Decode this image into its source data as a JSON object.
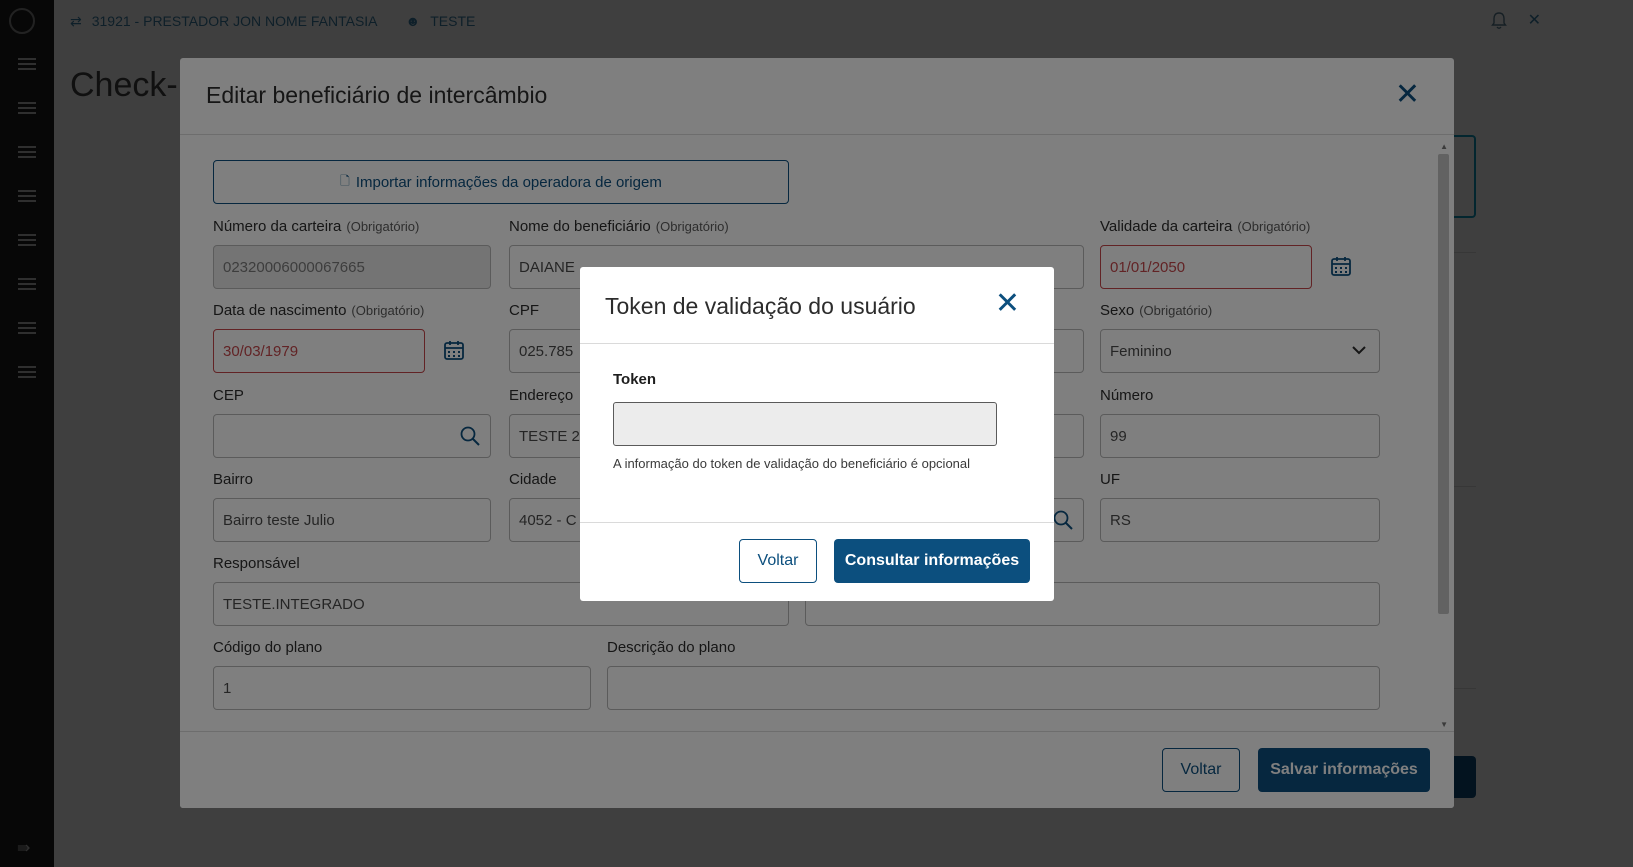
{
  "topbar": {
    "provider": "31921 - PRESTADOR JON NOME FANTASIA",
    "user": "TESTE"
  },
  "page": {
    "title_fragment": "Check-i"
  },
  "edit_modal": {
    "title": "Editar beneficiário de intercâmbio",
    "import_button": "Importar informações da operadora de origem",
    "required_tag": "(Obrigatório)",
    "fields": {
      "card_number": {
        "label": "Número da carteira",
        "value": "02320006000067665"
      },
      "beneficiary_name": {
        "label": "Nome do beneficiário",
        "value": "DAIANE"
      },
      "card_validity": {
        "label": "Validade da carteira",
        "value": "01/01/2050"
      },
      "birth_date": {
        "label": "Data de nascimento",
        "value": "30/03/1979"
      },
      "cpf": {
        "label": "CPF",
        "value": "025.785"
      },
      "sex": {
        "label": "Sexo",
        "value": "Feminino"
      },
      "cep": {
        "label": "CEP",
        "value": ""
      },
      "address": {
        "label": "Endereço",
        "value": "TESTE 2"
      },
      "number": {
        "label": "Número",
        "value": "99"
      },
      "neighborhood": {
        "label": "Bairro",
        "value": "Bairro teste Julio"
      },
      "city": {
        "label": "Cidade",
        "value": "4052 - C"
      },
      "uf": {
        "label": "UF",
        "value": "RS"
      },
      "responsible": {
        "label": "Responsável",
        "value": "TESTE.INTEGRADO"
      },
      "plan_code": {
        "label": "Código do plano",
        "value": "1"
      },
      "plan_description": {
        "label": "Descrição do plano",
        "value": ""
      }
    },
    "back_button": "Voltar",
    "save_button": "Salvar informações"
  },
  "token_dialog": {
    "title": "Token de validação do usuário",
    "token_label": "Token",
    "token_value": "",
    "help_text": "A informação do token de validação do beneficiário é opcional",
    "back_button": "Voltar",
    "consult_button": "Consultar informações"
  },
  "colors": {
    "primary": "#0c4f7e",
    "error": "#c4474b",
    "overlay": "rgba(0,0,0,0.5)"
  }
}
